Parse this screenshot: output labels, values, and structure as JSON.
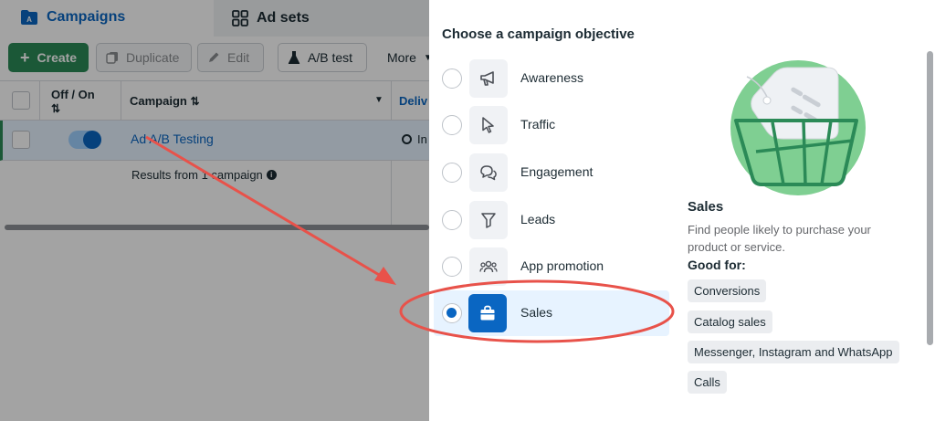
{
  "tabs": [
    {
      "label": "Campaigns",
      "icon": "campaigns-folder-icon"
    },
    {
      "label": "Ad sets",
      "icon": "ad-sets-grid-icon"
    }
  ],
  "toolbar": {
    "create_label": "Create",
    "duplicate_label": "Duplicate",
    "edit_label": "Edit",
    "ab_test_label": "A/B test",
    "more_label": "More"
  },
  "table": {
    "columns": [
      "Off / On",
      "Campaign",
      "Deliv"
    ],
    "row": {
      "campaign_name": "Ad A/B Testing",
      "delivery": "In"
    },
    "results_text": "Results from 1 campaign"
  },
  "modal": {
    "title": "Choose a campaign objective",
    "objectives": [
      {
        "label": "Awareness",
        "icon": "megaphone-icon",
        "selected": false
      },
      {
        "label": "Traffic",
        "icon": "cursor-icon",
        "selected": false
      },
      {
        "label": "Engagement",
        "icon": "chat-bubbles-icon",
        "selected": false
      },
      {
        "label": "Leads",
        "icon": "funnel-icon",
        "selected": false
      },
      {
        "label": "App promotion",
        "icon": "people-icon",
        "selected": false
      },
      {
        "label": "Sales",
        "icon": "shopping-bag-icon",
        "selected": true
      }
    ],
    "detail": {
      "title": "Sales",
      "description": "Find people likely to purchase your product or service.",
      "good_for_label": "Good for:",
      "tags": [
        "Conversions",
        "Catalog sales",
        "Messenger, Instagram and WhatsApp",
        "Calls"
      ]
    }
  },
  "colors": {
    "brand_blue": "#0a66c2",
    "create_green": "#2b8a57",
    "annotation_red": "#e8524a",
    "illustration_green": "#7fcf92"
  }
}
